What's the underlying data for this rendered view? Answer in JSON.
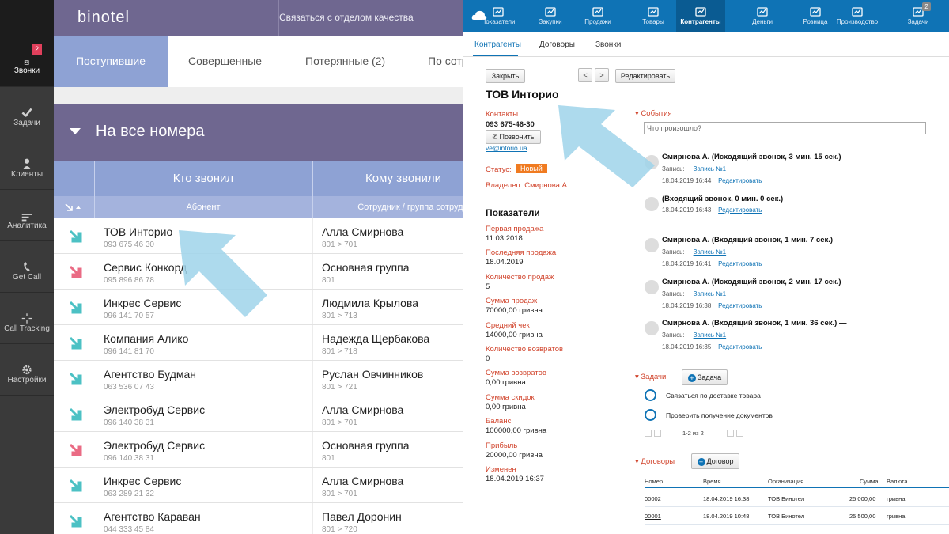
{
  "binotel": {
    "logo": "binotel",
    "quality_link": "Связаться с отделом качества",
    "sidebar": [
      {
        "label": "Звонки",
        "icon": "calls-icon",
        "badge": "2",
        "active": true
      },
      {
        "label": "Задачи",
        "icon": "check-icon"
      },
      {
        "label": "Клиенты",
        "icon": "person-icon"
      },
      {
        "label": "Аналитика",
        "icon": "analytics-icon"
      },
      {
        "label": "Get Call",
        "icon": "phone-icon"
      },
      {
        "label": "Call Tracking",
        "icon": "crosshair-icon"
      },
      {
        "label": "Настройки",
        "icon": "gear-icon"
      }
    ],
    "tabs": [
      "Поступившие",
      "Совершенные",
      "Потерянные (2)",
      "По сотр"
    ],
    "section_title": "На все номера",
    "header": {
      "who_called": "Кто звонил",
      "whom_called": "Кому звонили",
      "subscriber": "Абонент",
      "employee_group": "Сотрудник / группа сотрудни"
    },
    "rows": [
      {
        "name": "ТОВ Инторио",
        "phone": "093 675 46 30",
        "to": "Алла Смирнова",
        "ext": "801 > 701",
        "dir": "in"
      },
      {
        "name": "Сервис Конкорд",
        "phone": "095 896 86 78",
        "to": "Основная группа",
        "ext": "801",
        "dir": "missed"
      },
      {
        "name": "Инкрес Сервис",
        "phone": "096 141 70 57",
        "to": "Людмила Крылова",
        "ext": "801 > 713",
        "dir": "in"
      },
      {
        "name": "Компания Алико",
        "phone": "096 141 81 70",
        "to": "Надежда Щербакова",
        "ext": "801 > 718",
        "dir": "in"
      },
      {
        "name": "Агентство Будман",
        "phone": "063 536 07 43",
        "to": "Руслан Овчинников",
        "ext": "801 > 721",
        "dir": "in"
      },
      {
        "name": "Электробуд Сервис",
        "phone": "096 140 38 31",
        "to": "Алла Смирнова",
        "ext": "801 > 701",
        "dir": "in"
      },
      {
        "name": "Электробуд Сервис",
        "phone": "096 140 38 31",
        "to": "Основная группа",
        "ext": "801",
        "dir": "missed"
      },
      {
        "name": "Инкрес Сервис",
        "phone": "063 289 21 32",
        "to": "Алла Смирнова",
        "ext": "801 > 701",
        "dir": "in"
      },
      {
        "name": "Агентство Караван",
        "phone": "044 333 45 84",
        "to": "Павел Доронин",
        "ext": "801 > 720",
        "dir": "in"
      }
    ]
  },
  "crm": {
    "nav": [
      "Показатели",
      "Закупки",
      "Продажи",
      "Товары",
      "Контрагенты",
      "Деньги",
      "Розница",
      "Производство",
      "Задачи"
    ],
    "nav_badge": "2",
    "subtabs": [
      "Контрагенты",
      "Договоры",
      "Звонки"
    ],
    "buttons": {
      "close": "Закрыть",
      "prev": "<",
      "next": ">",
      "edit": "Редактировать",
      "call": "Позвонить",
      "task": "Задача",
      "contract": "Договор"
    },
    "company": "ТОВ Инторио",
    "contacts_label": "Контакты",
    "phone": "093 675-46-30",
    "email": "ve@intorio.ua",
    "status_label": "Статус:",
    "status_value": "Новый",
    "owner": "Владелец: Смирнова А.",
    "metrics_title": "Показатели",
    "metrics": [
      {
        "label": "Первая продажа",
        "value": "11.03.2018"
      },
      {
        "label": "Последняя продажа",
        "value": "18.04.2019"
      },
      {
        "label": "Количество продаж",
        "value": "5"
      },
      {
        "label": "Сумма продаж",
        "value": "70000,00 гривна"
      },
      {
        "label": "Средний чек",
        "value": "14000,00 гривна"
      },
      {
        "label": "Количество возвратов",
        "value": "0"
      },
      {
        "label": "Сумма возвратов",
        "value": "0,00 гривна"
      },
      {
        "label": "Сумма скидок",
        "value": "0,00 гривна"
      },
      {
        "label": "Баланс",
        "value": "100000,00 гривна"
      },
      {
        "label": "Прибыль",
        "value": "20000,00 гривна"
      },
      {
        "label": "Изменен",
        "value": "18.04.2019 16:37"
      }
    ],
    "events_title": "События",
    "events_placeholder": "Что произошло?",
    "events": [
      {
        "title": "Смирнова А. (Исходящий звонок, 3 мин. 15 сек.) —",
        "record": "Запись:",
        "rec_link": "Запись №1",
        "date": "18.04.2019 16:44",
        "edit": "Редактировать"
      },
      {
        "title": "(Входящий звонок, 0 мин. 0 сек.) —",
        "record": "",
        "rec_link": "",
        "date": "18.04.2019 16:43",
        "edit": "Редактировать"
      },
      {
        "title": "Смирнова А. (Входящий звонок, 1 мин. 7 сек.) —",
        "record": "Запись:",
        "rec_link": "Запись №1",
        "date": "18.04.2019 16:41",
        "edit": "Редактировать"
      },
      {
        "title": "Смирнова А. (Исходящий звонок, 2 мин. 17 сек.) —",
        "record": "Запись:",
        "rec_link": "Запись №1",
        "date": "18.04.2019 16:38",
        "edit": "Редактировать"
      },
      {
        "title": "Смирнова А. (Входящий звонок, 1 мин. 36 сек.) —",
        "record": "Запись:",
        "rec_link": "Запись №1",
        "date": "18.04.2019 16:35",
        "edit": "Редактировать"
      }
    ],
    "tasks_title": "Задачи",
    "tasks": [
      "Связаться по доставке товара",
      "Проверить получение документов"
    ],
    "tasks_pager": "1-2 из 2",
    "contracts_title": "Договоры",
    "contracts_headers": [
      "Номер",
      "Время",
      "Организация",
      "Сумма",
      "Валюта"
    ],
    "contracts": [
      {
        "num": "00002",
        "time": "18.04.2019 16:38",
        "org": "ТОВ Бинотел",
        "sum": "25 000,00",
        "cur": "гривна"
      },
      {
        "num": "00001",
        "time": "18.04.2019 10:48",
        "org": "ТОВ Бинотел",
        "sum": "25 500,00",
        "cur": "гривна"
      }
    ],
    "colors": {
      "brand": "#0f73b5",
      "accent": "#d1442c",
      "status": "#f07b21"
    }
  },
  "colors": {
    "binotel_purple": "#6f6790",
    "binotel_blue": "#8ea2d4",
    "arrow_highlight": "#9fd3ea"
  }
}
